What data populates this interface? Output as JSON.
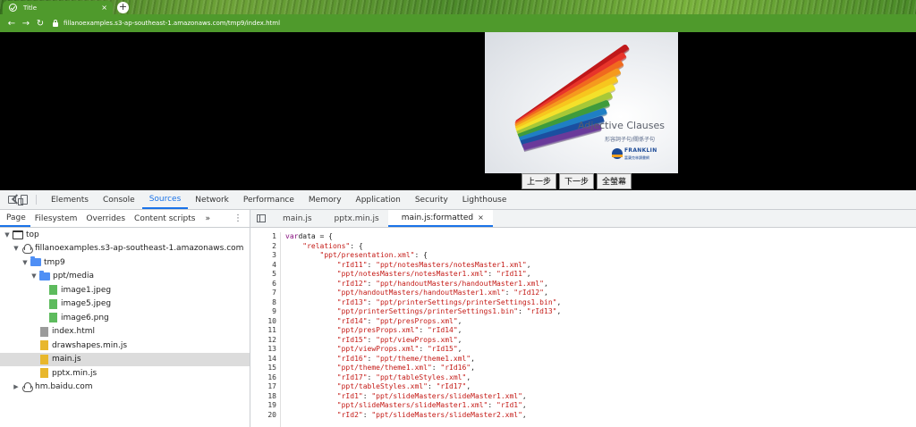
{
  "browser": {
    "tab_title": "Title",
    "tab_close": "×",
    "new_tab": "+",
    "nav_back": "←",
    "nav_forward": "→",
    "nav_reload": "↻",
    "url": "fillanoexamples.s3-ap-southeast-1.amazonaws.com/tmp9/index.html",
    "accent_color": "#4f9a2c"
  },
  "slide": {
    "title": "Adjective Clauses",
    "subtitle": "形容詞子句/關係子句",
    "logo_text": "FRANKLIN",
    "logo_subtext": "富蘭克林讀書網",
    "buttons": {
      "prev": "上一步",
      "next": "下一步",
      "fullscreen": "全螢幕"
    }
  },
  "devtools": {
    "tabs": [
      "Elements",
      "Console",
      "Sources",
      "Network",
      "Performance",
      "Memory",
      "Application",
      "Security",
      "Lighthouse"
    ],
    "active_tab": "Sources",
    "navigator_tabs": [
      "Page",
      "Filesystem",
      "Overrides",
      "Content scripts"
    ],
    "navigator_more": "»",
    "navigator_menu": "⋮",
    "tree": [
      {
        "label": "top",
        "type": "frame",
        "depth": 0,
        "expanded": true
      },
      {
        "label": "fillanoexamples.s3-ap-southeast-1.amazonaws.com",
        "type": "cloud",
        "depth": 1,
        "expanded": true
      },
      {
        "label": "tmp9",
        "type": "folder",
        "depth": 2,
        "expanded": true
      },
      {
        "label": "ppt/media",
        "type": "folder",
        "depth": 3,
        "expanded": true
      },
      {
        "label": "image1.jpeg",
        "type": "img",
        "depth": 4
      },
      {
        "label": "image5.jpeg",
        "type": "img",
        "depth": 4
      },
      {
        "label": "image6.png",
        "type": "img",
        "depth": 4
      },
      {
        "label": "index.html",
        "type": "html",
        "depth": 3
      },
      {
        "label": "drawshapes.min.js",
        "type": "js",
        "depth": 3
      },
      {
        "label": "main.js",
        "type": "js",
        "depth": 3,
        "selected": true
      },
      {
        "label": "pptx.min.js",
        "type": "js",
        "depth": 3
      },
      {
        "label": "hm.baidu.com",
        "type": "cloud",
        "depth": 1,
        "expanded": false
      }
    ],
    "editor_tabs": [
      {
        "label": "main.js"
      },
      {
        "label": "pptx.min.js"
      },
      {
        "label": "main.js:formatted",
        "active": true,
        "close": "×"
      }
    ],
    "code_lines": [
      [
        [
          "kw",
          "var"
        ],
        [
          "",
          "data = {"
        ]
      ],
      [
        [
          "",
          "    "
        ],
        [
          "str",
          "\"relations\""
        ],
        [
          "",
          ": {"
        ]
      ],
      [
        [
          "",
          "        "
        ],
        [
          "str",
          "\"ppt/presentation.xml\""
        ],
        [
          "",
          ": {"
        ]
      ],
      [
        [
          "",
          "            "
        ],
        [
          "str",
          "\"rId11\""
        ],
        [
          "",
          ": "
        ],
        [
          "str",
          "\"ppt/notesMasters/notesMaster1.xml\""
        ],
        [
          "",
          ","
        ]
      ],
      [
        [
          "",
          "            "
        ],
        [
          "str",
          "\"ppt/notesMasters/notesMaster1.xml\""
        ],
        [
          "",
          ": "
        ],
        [
          "str",
          "\"rId11\""
        ],
        [
          "",
          ","
        ]
      ],
      [
        [
          "",
          "            "
        ],
        [
          "str",
          "\"rId12\""
        ],
        [
          "",
          ": "
        ],
        [
          "str",
          "\"ppt/handoutMasters/handoutMaster1.xml\""
        ],
        [
          "",
          ","
        ]
      ],
      [
        [
          "",
          "            "
        ],
        [
          "str",
          "\"ppt/handoutMasters/handoutMaster1.xml\""
        ],
        [
          "",
          ": "
        ],
        [
          "str",
          "\"rId12\""
        ],
        [
          "",
          ","
        ]
      ],
      [
        [
          "",
          "            "
        ],
        [
          "str",
          "\"rId13\""
        ],
        [
          "",
          ": "
        ],
        [
          "str",
          "\"ppt/printerSettings/printerSettings1.bin\""
        ],
        [
          "",
          ","
        ]
      ],
      [
        [
          "",
          "            "
        ],
        [
          "str",
          "\"ppt/printerSettings/printerSettings1.bin\""
        ],
        [
          "",
          ": "
        ],
        [
          "str",
          "\"rId13\""
        ],
        [
          "",
          ","
        ]
      ],
      [
        [
          "",
          "            "
        ],
        [
          "str",
          "\"rId14\""
        ],
        [
          "",
          ": "
        ],
        [
          "str",
          "\"ppt/presProps.xml\""
        ],
        [
          "",
          ","
        ]
      ],
      [
        [
          "",
          "            "
        ],
        [
          "str",
          "\"ppt/presProps.xml\""
        ],
        [
          "",
          ": "
        ],
        [
          "str",
          "\"rId14\""
        ],
        [
          "",
          ","
        ]
      ],
      [
        [
          "",
          "            "
        ],
        [
          "str",
          "\"rId15\""
        ],
        [
          "",
          ": "
        ],
        [
          "str",
          "\"ppt/viewProps.xml\""
        ],
        [
          "",
          ","
        ]
      ],
      [
        [
          "",
          "            "
        ],
        [
          "str",
          "\"ppt/viewProps.xml\""
        ],
        [
          "",
          ": "
        ],
        [
          "str",
          "\"rId15\""
        ],
        [
          "",
          ","
        ]
      ],
      [
        [
          "",
          "            "
        ],
        [
          "str",
          "\"rId16\""
        ],
        [
          "",
          ": "
        ],
        [
          "str",
          "\"ppt/theme/theme1.xml\""
        ],
        [
          "",
          ","
        ]
      ],
      [
        [
          "",
          "            "
        ],
        [
          "str",
          "\"ppt/theme/theme1.xml\""
        ],
        [
          "",
          ": "
        ],
        [
          "str",
          "\"rId16\""
        ],
        [
          "",
          ","
        ]
      ],
      [
        [
          "",
          "            "
        ],
        [
          "str",
          "\"rId17\""
        ],
        [
          "",
          ": "
        ],
        [
          "str",
          "\"ppt/tableStyles.xml\""
        ],
        [
          "",
          ","
        ]
      ],
      [
        [
          "",
          "            "
        ],
        [
          "str",
          "\"ppt/tableStyles.xml\""
        ],
        [
          "",
          ": "
        ],
        [
          "str",
          "\"rId17\""
        ],
        [
          "",
          ","
        ]
      ],
      [
        [
          "",
          "            "
        ],
        [
          "str",
          "\"rId1\""
        ],
        [
          "",
          ": "
        ],
        [
          "str",
          "\"ppt/slideMasters/slideMaster1.xml\""
        ],
        [
          "",
          ","
        ]
      ],
      [
        [
          "",
          "            "
        ],
        [
          "str",
          "\"ppt/slideMasters/slideMaster1.xml\""
        ],
        [
          "",
          ": "
        ],
        [
          "str",
          "\"rId1\""
        ],
        [
          "",
          ","
        ]
      ],
      [
        [
          "",
          "            "
        ],
        [
          "str",
          "\"rId2\""
        ],
        [
          "",
          ": "
        ],
        [
          "str",
          "\"ppt/slideMasters/slideMaster2.xml\""
        ],
        [
          "",
          ","
        ]
      ]
    ]
  }
}
